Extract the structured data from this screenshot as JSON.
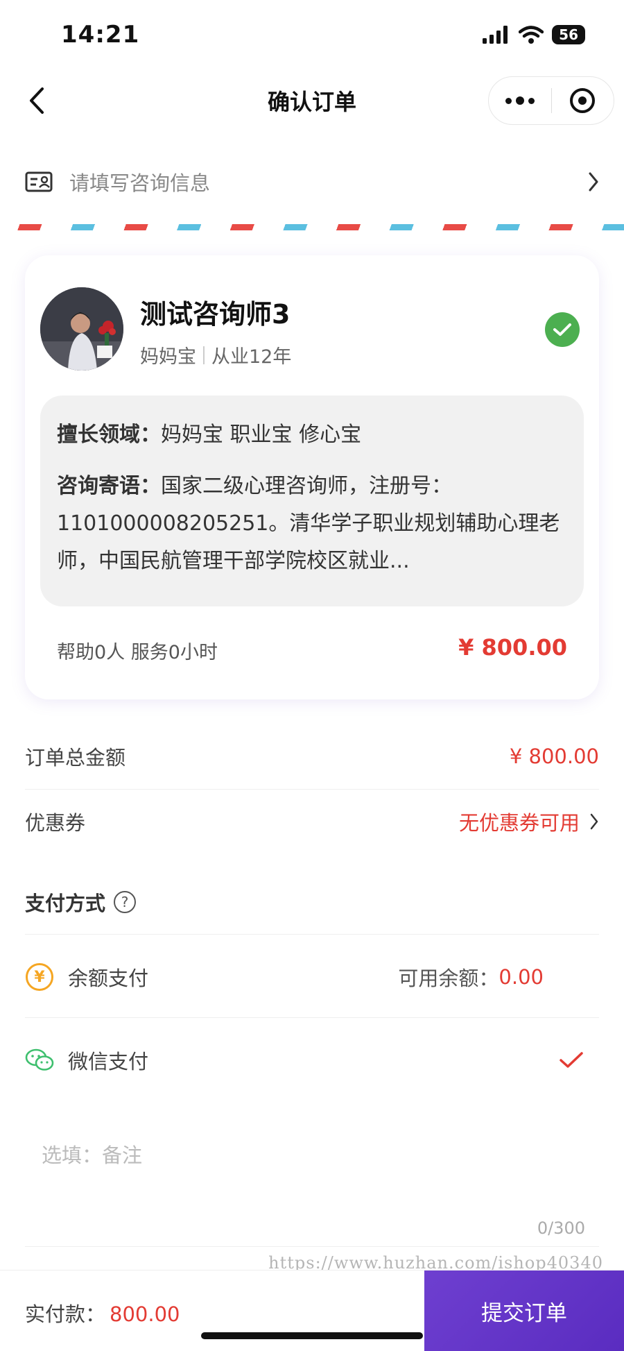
{
  "status_bar": {
    "time": "14:21",
    "battery": "56"
  },
  "nav": {
    "title": "确认订单",
    "more_icon": "more-dots-icon",
    "close_icon": "target-icon"
  },
  "consult_info": {
    "placeholder": "请填写咨询信息",
    "icon": "id-card-icon"
  },
  "counselor": {
    "name": "测试咨询师3",
    "tag": "妈妈宝",
    "experience": "从业12年",
    "specialty_label": "擅长领域：",
    "specialty": "妈妈宝 职业宝 修心宝",
    "motto_label": "咨询寄语：",
    "motto": "国家二级心理咨询师，注册号：1101000008205251。清华学子职业规划辅助心理老师，中国民航管理干部学院校区就业...",
    "stats": "帮助0人 服务0小时",
    "price": "¥ 800.00",
    "selected": true
  },
  "order": {
    "total_label": "订单总金额",
    "total_value": "¥ 800.00",
    "coupon_label": "优惠券",
    "coupon_value": "无优惠券可用"
  },
  "payment": {
    "title": "支付方式",
    "help": "?",
    "options": [
      {
        "label": "余额支付",
        "icon": "yen-circle-icon",
        "balance_label": "可用余额：",
        "balance_value": "0.00"
      },
      {
        "label": "微信支付",
        "icon": "wechat-icon",
        "selected": true
      }
    ]
  },
  "remark": {
    "placeholder": "选填：备注",
    "counter": "0/300"
  },
  "watermark": "https://www.huzhan.com/ishop40340",
  "footer": {
    "total_label": "实付款：",
    "total_value": "800.00",
    "submit": "提交订单"
  },
  "colors": {
    "accent_red": "#e33b33",
    "submit_purple": "#6239c8",
    "check_green": "#4caf50"
  }
}
